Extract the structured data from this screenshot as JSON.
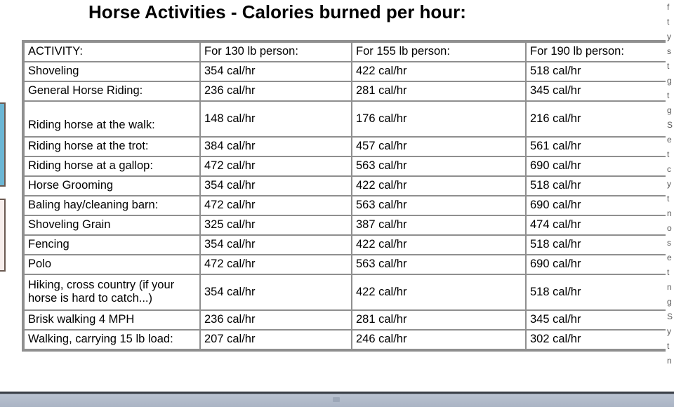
{
  "page": {
    "title": "Horse Activities - Calories burned per hour:"
  },
  "table": {
    "headers": [
      "ACTIVITY:",
      "For 130 lb person:",
      "For 155 lb person:",
      "For 190 lb person:"
    ],
    "rows": [
      {
        "activity": "Shoveling",
        "w130": "354 cal/hr",
        "w155": "422 cal/hr",
        "w190": "518 cal/hr"
      },
      {
        "activity": "General Horse Riding:",
        "w130": "236 cal/hr",
        "w155": "281 cal/hr",
        "w190": "345 cal/hr"
      },
      {
        "activity": "Riding horse at the walk:",
        "w130": "148 cal/hr",
        "w155": "176 cal/hr",
        "w190": "216 cal/hr"
      },
      {
        "activity": "Riding horse at the trot:",
        "w130": "384 cal/hr",
        "w155": "457 cal/hr",
        "w190": "561 cal/hr"
      },
      {
        "activity": "Riding horse at a gallop:",
        "w130": "472 cal/hr",
        "w155": "563 cal/hr",
        "w190": "690 cal/hr"
      },
      {
        "activity": "Horse Grooming",
        "w130": "354 cal/hr",
        "w155": "422 cal/hr",
        "w190": "518 cal/hr"
      },
      {
        "activity": "Baling hay/cleaning barn:",
        "w130": "472 cal/hr",
        "w155": "563 cal/hr",
        "w190": "690 cal/hr"
      },
      {
        "activity": "Shoveling Grain",
        "w130": "325 cal/hr",
        "w155": "387 cal/hr",
        "w190": "474 cal/hr"
      },
      {
        "activity": "Fencing",
        "w130": "354 cal/hr",
        "w155": "422 cal/hr",
        "w190": "518 cal/hr"
      },
      {
        "activity": "Polo",
        "w130": "472 cal/hr",
        "w155": "563 cal/hr",
        "w190": "690 cal/hr"
      },
      {
        "activity": "Hiking, cross country (if your horse is hard to catch...)",
        "w130": "354 cal/hr",
        "w155": "422 cal/hr",
        "w190": "518 cal/hr"
      },
      {
        "activity": "Brisk walking 4 MPH",
        "w130": "236 cal/hr",
        "w155": "281 cal/hr",
        "w190": "345 cal/hr"
      },
      {
        "activity": "Walking, carrying 15 lb load:",
        "w130": "207 cal/hr",
        "w155": "246 cal/hr",
        "w190": "302 cal/hr"
      }
    ]
  },
  "edge_widgets": {
    "blue_box_color": "#6cb6d4",
    "pink_box_color": "#f7eeec",
    "border_color": "#6b5a52"
  },
  "right_sliver": {
    "lines": [
      "f",
      "t",
      "y",
      "s",
      "t",
      "g",
      "t",
      "g",
      "S",
      "e",
      "t",
      "c",
      "y",
      "t",
      "n",
      "o",
      "s",
      "e",
      "t",
      "n",
      "g",
      "S",
      "y",
      "t",
      "n"
    ]
  },
  "bottom_bar": {
    "color": "#aeb8c8",
    "divider_color": "#3a3f47"
  }
}
